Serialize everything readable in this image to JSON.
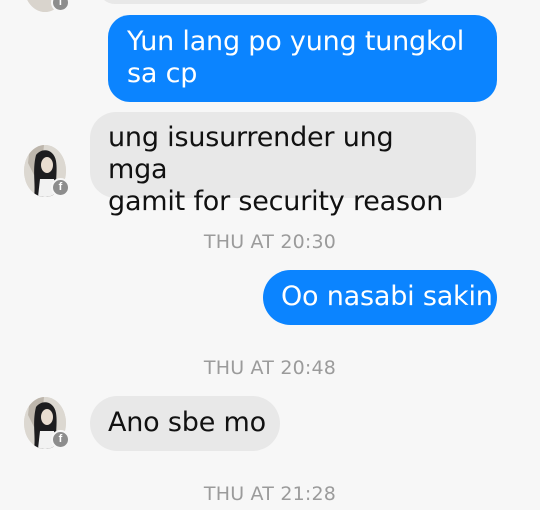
{
  "messages": [
    {
      "text": "Yun lang po yung tungkol\nsa cp"
    },
    {
      "text": "ung isusurrender ung mga\ngamit for security reason"
    },
    {
      "text": "Oo nasabi sakin"
    },
    {
      "text": "Ano sbe mo"
    }
  ],
  "timestamps": [
    "THU AT 20:30",
    "THU AT 20:48",
    "THU AT 21:28"
  ],
  "badge_icon": "messenger-facebook-badge",
  "colors": {
    "outgoing_bubble": "#0b84ff",
    "incoming_bubble": "#e8e8e8",
    "timestamp": "#9b9b9b"
  }
}
